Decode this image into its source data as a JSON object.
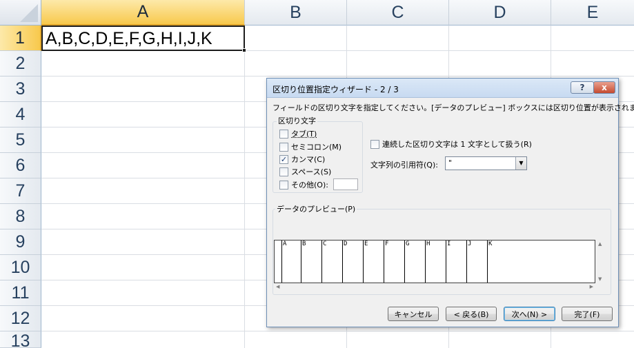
{
  "sheet": {
    "columns": [
      "A",
      "B",
      "C",
      "D",
      "E"
    ],
    "rows": [
      "1",
      "2",
      "3",
      "4",
      "5",
      "6",
      "7",
      "8",
      "9",
      "10",
      "11",
      "12",
      "13"
    ],
    "cell_a1": "A,B,C,D,E,F,G,H,I,J,K",
    "selected_column": "A",
    "selected_row": "1"
  },
  "dialog": {
    "title": "区切り位置指定ウィザード - 2 / 3",
    "help_label": "?",
    "close_label": "x",
    "instruction": "フィールドの区切り文字を指定してください。[データのプレビュー] ボックスには区切り位置が表示されます。",
    "delimiters": {
      "group_label": "区切り文字",
      "tab": {
        "label": "タブ(T)",
        "checked": false
      },
      "semicolon": {
        "label": "セミコロン(M)",
        "checked": false
      },
      "comma": {
        "label": "カンマ(C)",
        "checked": true
      },
      "space": {
        "label": "スペース(S)",
        "checked": false
      },
      "other": {
        "label": "その他(O):",
        "checked": false,
        "value": ""
      }
    },
    "consecutive": {
      "label": "連続した区切り文字は 1 文字として扱う(R)",
      "checked": false
    },
    "text_qualifier": {
      "label": "文字列の引用符(Q):",
      "value": "\""
    },
    "preview": {
      "label": "データのプレビュー(P)",
      "columns": [
        "A",
        "B",
        "C",
        "D",
        "E",
        "F",
        "G",
        "H",
        "I",
        "J",
        "K"
      ]
    },
    "buttons": {
      "cancel": "キャンセル",
      "back": "< 戻る(B)",
      "next": "次へ(N) >",
      "finish": "完了(F)"
    }
  },
  "colors": {
    "selected_header": "#f8c94d",
    "header": "#e4e9ef",
    "dialog_bg": "#f0f0f0",
    "check_mark": "#1d3f76"
  }
}
